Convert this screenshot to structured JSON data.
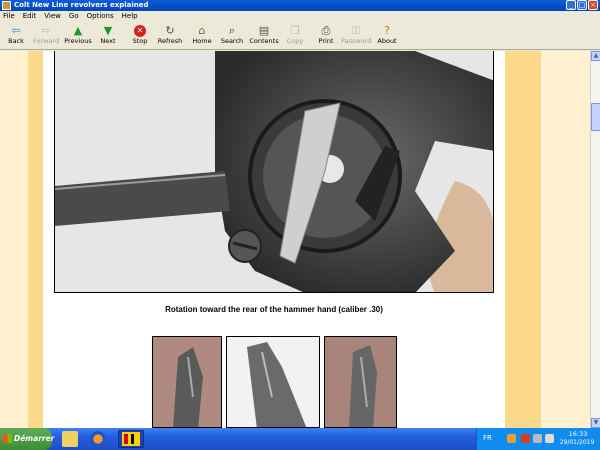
{
  "window": {
    "title": "Colt New Line revolvers explained"
  },
  "menu": [
    "File",
    "Edit",
    "View",
    "Go",
    "Options",
    "Help"
  ],
  "toolbar": [
    {
      "label": "Back",
      "icon": "back-arrow-icon",
      "enabled": true
    },
    {
      "label": "Forward",
      "icon": "forward-arrow-icon",
      "enabled": false
    },
    {
      "label": "Previous",
      "icon": "up-arrow-icon",
      "enabled": true
    },
    {
      "label": "Next",
      "icon": "down-arrow-icon",
      "enabled": true
    },
    {
      "label": "Stop",
      "icon": "stop-icon",
      "enabled": true
    },
    {
      "label": "Refresh",
      "icon": "refresh-icon",
      "enabled": true
    },
    {
      "label": "Home",
      "icon": "home-icon",
      "enabled": true
    },
    {
      "label": "Search",
      "icon": "search-icon",
      "enabled": true
    },
    {
      "label": "Contents",
      "icon": "contents-icon",
      "enabled": true
    },
    {
      "label": "Copy",
      "icon": "copy-icon",
      "enabled": false
    },
    {
      "label": "Print",
      "icon": "print-icon",
      "enabled": true
    },
    {
      "label": "Password",
      "icon": "key-icon",
      "enabled": false
    },
    {
      "label": "About",
      "icon": "about-icon",
      "enabled": true
    }
  ],
  "content": {
    "caption": "Rotation toward the rear of the hammer hand (caliber .30)"
  },
  "taskbar": {
    "start_label": "Démarrer",
    "language": "FR",
    "time": "16:33",
    "date": "29/01/2019"
  },
  "colors": {
    "page_bg": "#ffffff",
    "band_light": "#fff1d0",
    "band_dark": "#fcd88a",
    "titlebar": "#0a5fd8",
    "taskbar": "#245edb"
  }
}
